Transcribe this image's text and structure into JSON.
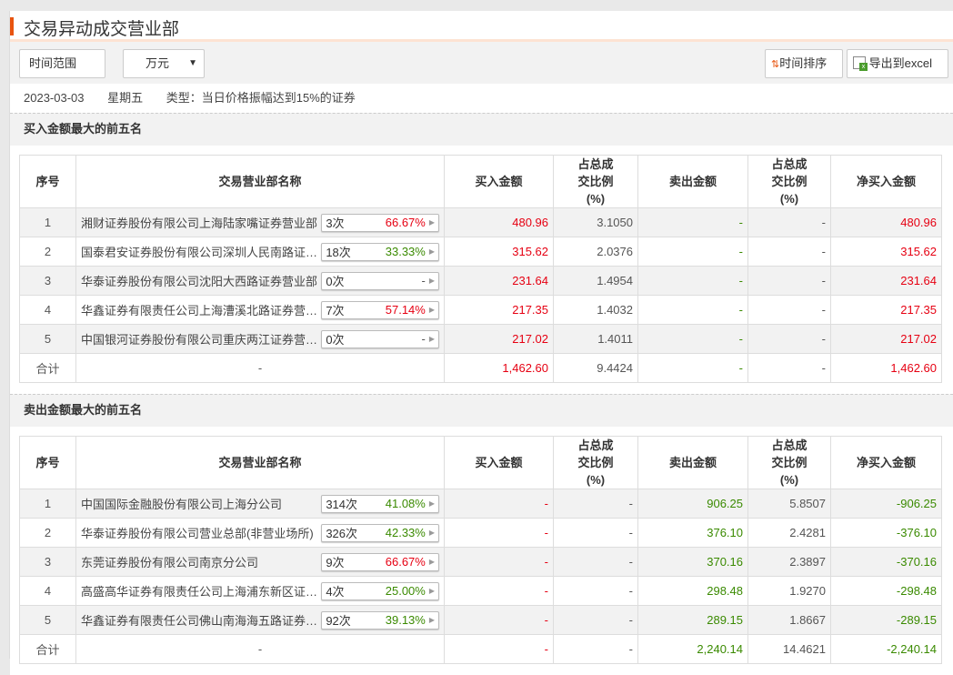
{
  "title": "交易异动成交营业部",
  "toolbar": {
    "time_range": "时间范围",
    "unit": "万元",
    "sort": "时间排序",
    "export": "导出到excel"
  },
  "info": {
    "date": "2023-03-03",
    "weekday": "星期五",
    "type": "类型：当日价格振幅达到15%的证券"
  },
  "columns": [
    "序号",
    "交易营业部名称",
    "买入金额",
    "占总成交比例(%)",
    "卖出金额",
    "占总成交比例(%)",
    "净买入金额"
  ],
  "buy_section": {
    "title": "买入金额最大的前五名",
    "rows": [
      {
        "no": "1",
        "name": "湘财证券股份有限公司上海陆家嘴证券营业部",
        "count": "3次",
        "rate": "66.67%",
        "rate_color": "red",
        "buy": "480.96",
        "buy_pct": "3.1050",
        "sell": "-",
        "sell_pct": "-",
        "net": "480.96"
      },
      {
        "no": "2",
        "name": "国泰君安证券股份有限公司深圳人民南路证券营业部",
        "count": "18次",
        "rate": "33.33%",
        "rate_color": "green",
        "buy": "315.62",
        "buy_pct": "2.0376",
        "sell": "-",
        "sell_pct": "-",
        "net": "315.62"
      },
      {
        "no": "3",
        "name": "华泰证券股份有限公司沈阳大西路证券营业部",
        "count": "0次",
        "rate": "-",
        "rate_color": "gray",
        "buy": "231.64",
        "buy_pct": "1.4954",
        "sell": "-",
        "sell_pct": "-",
        "net": "231.64"
      },
      {
        "no": "4",
        "name": "华鑫证券有限责任公司上海漕溪北路证券营业部",
        "count": "7次",
        "rate": "57.14%",
        "rate_color": "red",
        "buy": "217.35",
        "buy_pct": "1.4032",
        "sell": "-",
        "sell_pct": "-",
        "net": "217.35"
      },
      {
        "no": "5",
        "name": "中国银河证券股份有限公司重庆两江证券营业部",
        "count": "0次",
        "rate": "-",
        "rate_color": "gray",
        "buy": "217.02",
        "buy_pct": "1.4011",
        "sell": "-",
        "sell_pct": "-",
        "net": "217.02"
      }
    ],
    "total": {
      "label": "合计",
      "name": "-",
      "buy": "1,462.60",
      "buy_pct": "9.4424",
      "sell": "-",
      "sell_pct": "-",
      "net": "1,462.60"
    }
  },
  "sell_section": {
    "title": "卖出金额最大的前五名",
    "rows": [
      {
        "no": "1",
        "name": "中国国际金融股份有限公司上海分公司",
        "count": "314次",
        "rate": "41.08%",
        "rate_color": "green",
        "buy": "-",
        "buy_pct": "-",
        "sell": "906.25",
        "sell_pct": "5.8507",
        "net": "-906.25"
      },
      {
        "no": "2",
        "name": "华泰证券股份有限公司营业总部(非营业场所)",
        "count": "326次",
        "rate": "42.33%",
        "rate_color": "green",
        "buy": "-",
        "buy_pct": "-",
        "sell": "376.10",
        "sell_pct": "2.4281",
        "net": "-376.10"
      },
      {
        "no": "3",
        "name": "东莞证券股份有限公司南京分公司",
        "count": "9次",
        "rate": "66.67%",
        "rate_color": "red",
        "buy": "-",
        "buy_pct": "-",
        "sell": "370.16",
        "sell_pct": "2.3897",
        "net": "-370.16"
      },
      {
        "no": "4",
        "name": "高盛高华证券有限责任公司上海浦东新区证券营业部",
        "count": "4次",
        "rate": "25.00%",
        "rate_color": "green",
        "buy": "-",
        "buy_pct": "-",
        "sell": "298.48",
        "sell_pct": "1.9270",
        "net": "-298.48"
      },
      {
        "no": "5",
        "name": "华鑫证券有限责任公司佛山南海海五路证券营业部",
        "count": "92次",
        "rate": "39.13%",
        "rate_color": "green",
        "buy": "-",
        "buy_pct": "-",
        "sell": "289.15",
        "sell_pct": "1.8667",
        "net": "-289.15"
      }
    ],
    "total": {
      "label": "合计",
      "name": "-",
      "buy": "-",
      "buy_pct": "-",
      "sell": "2,240.14",
      "sell_pct": "14.4621",
      "net": "-2,240.14"
    }
  }
}
